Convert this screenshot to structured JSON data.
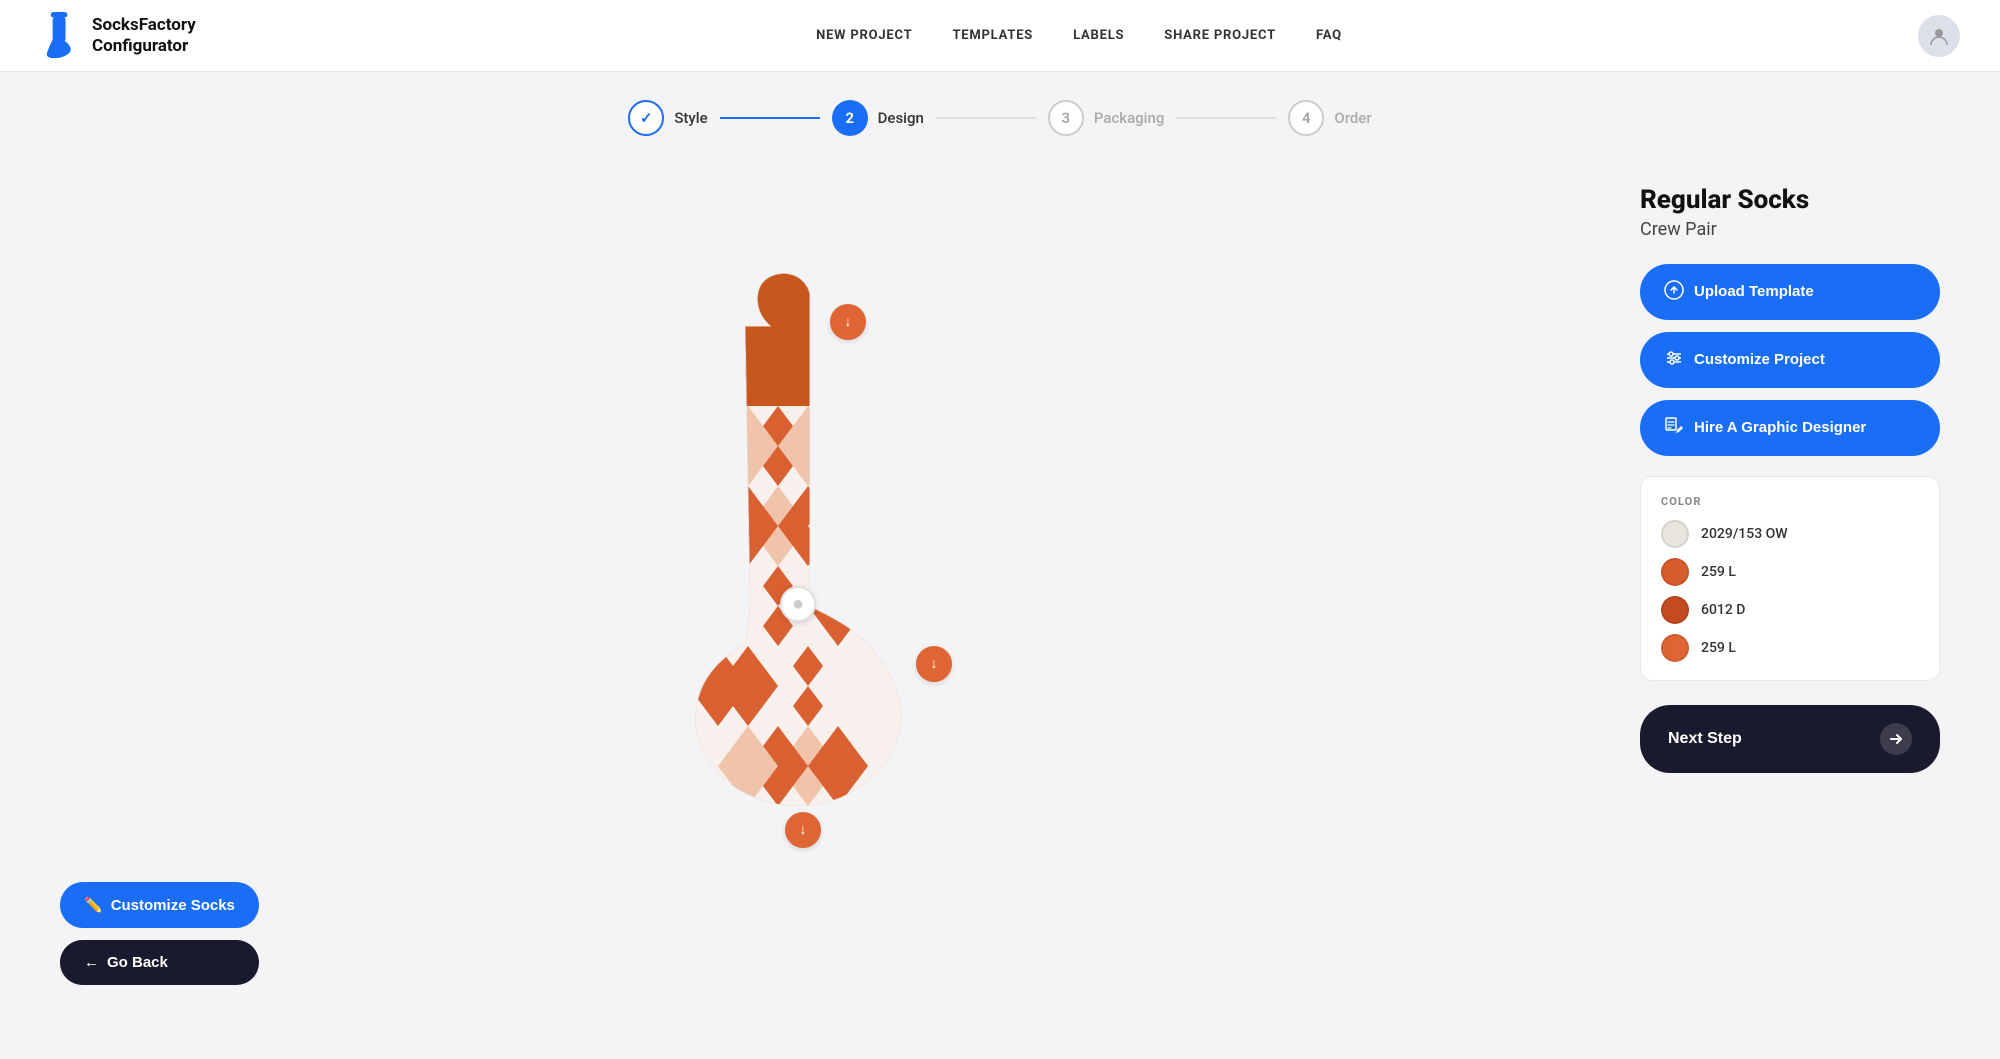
{
  "header": {
    "logo_name": "SocksFactory\nConfigurator",
    "nav_items": [
      "NEW PROJECT",
      "TEMPLATES",
      "LABELS",
      "SHARE PROJECT",
      "FAQ"
    ]
  },
  "stepper": {
    "steps": [
      {
        "number": "✓",
        "label": "Style",
        "state": "done"
      },
      {
        "number": "2",
        "label": "Design",
        "state": "active"
      },
      {
        "number": "3",
        "label": "Packaging",
        "state": "inactive"
      },
      {
        "number": "4",
        "label": "Order",
        "state": "inactive"
      }
    ]
  },
  "product": {
    "title": "Regular Socks",
    "subtitle": "Crew Pair"
  },
  "action_buttons": [
    {
      "label": "Upload Template",
      "icon": "upload"
    },
    {
      "label": "Customize Project",
      "icon": "sliders"
    },
    {
      "label": "Hire A Graphic Designer",
      "icon": "pen"
    }
  ],
  "color_panel": {
    "title": "COLOR",
    "colors": [
      {
        "hex": "#e8e4de",
        "label": "2029/153 OW"
      },
      {
        "hex": "#d95c2b",
        "label": "259 L"
      },
      {
        "hex": "#c44a20",
        "label": "6012 D"
      },
      {
        "hex": "#e06535",
        "label": "259 L"
      }
    ]
  },
  "bottom_left_buttons": {
    "customize": "Customize Socks",
    "go_back": "Go Back"
  },
  "next_step": "Next Step"
}
